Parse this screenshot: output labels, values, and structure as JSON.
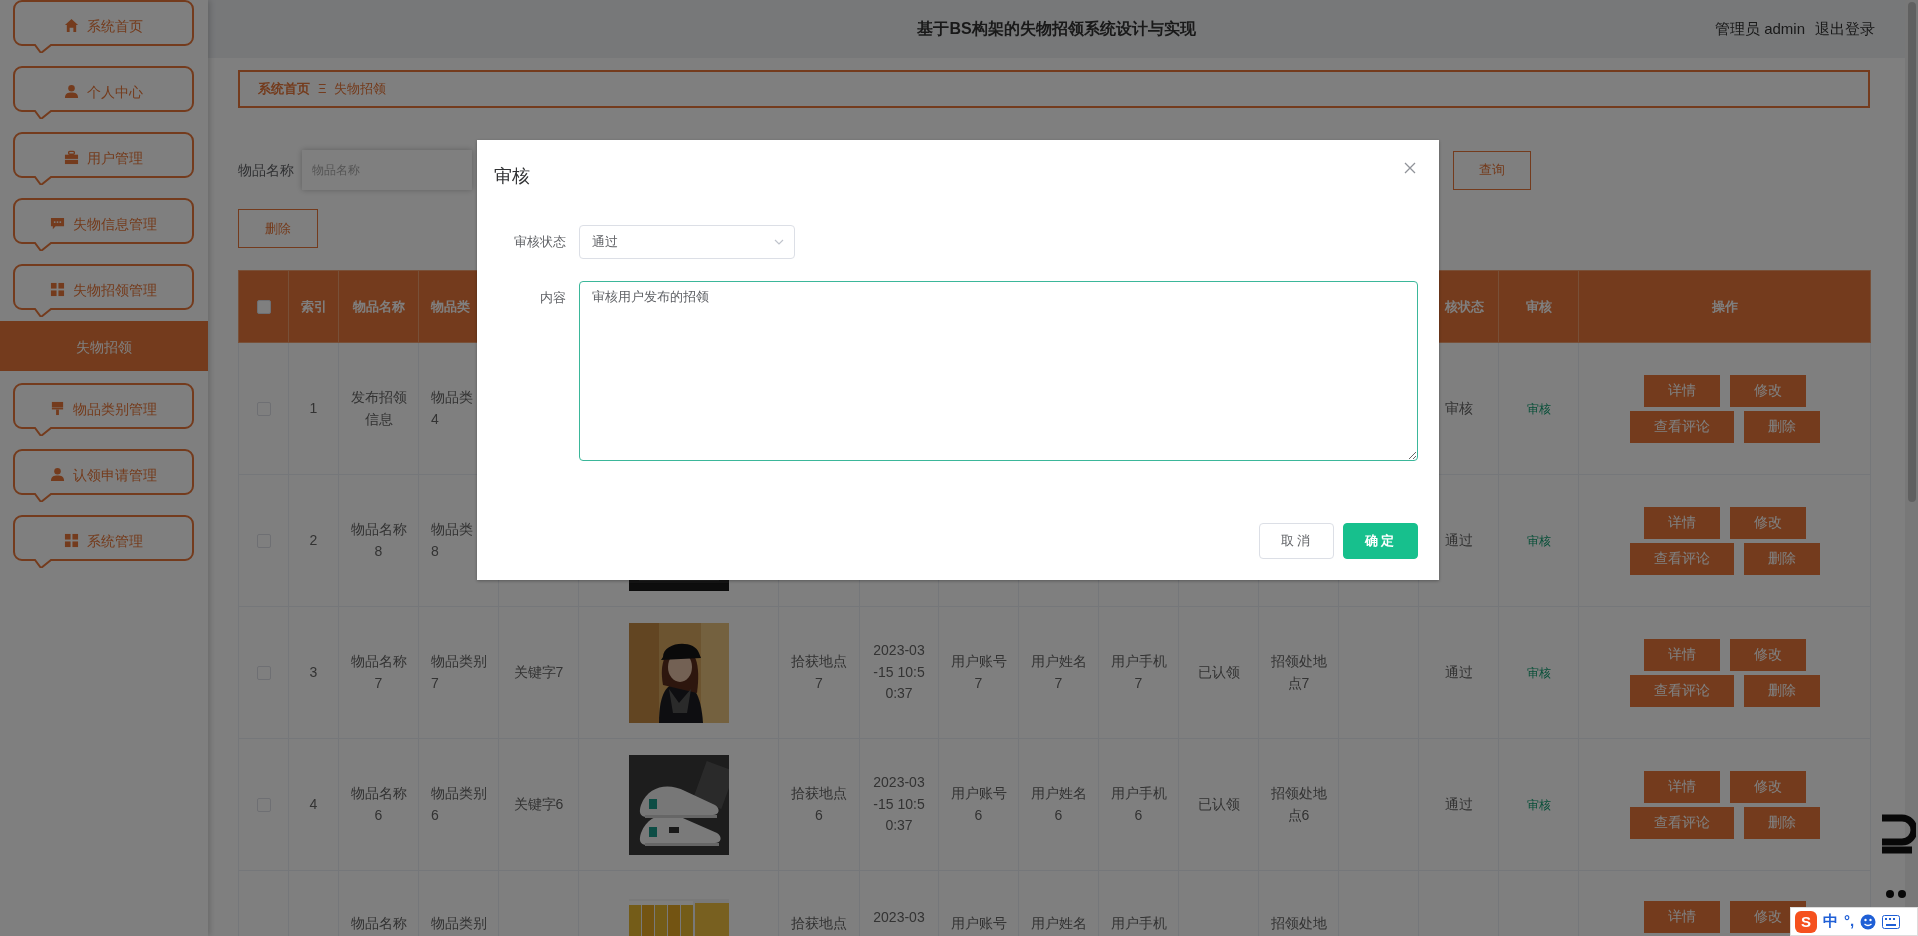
{
  "header": {
    "title": "基于BS构架的失物招领系统设计与实现",
    "user": "管理员 admin",
    "logout": "退出登录"
  },
  "sidebar": {
    "items": [
      {
        "label": "系统首页",
        "selected": false
      },
      {
        "label": "个人中心",
        "selected": false
      },
      {
        "label": "用户管理",
        "selected": false
      },
      {
        "label": "失物信息管理",
        "selected": false
      },
      {
        "label": "失物招领管理",
        "selected": false,
        "children": [
          {
            "label": "失物招领",
            "selected": true
          }
        ]
      },
      {
        "label": "物品类别管理",
        "selected": false
      },
      {
        "label": "认领申请管理",
        "selected": false
      },
      {
        "label": "系统管理",
        "selected": false
      }
    ]
  },
  "breadcrumb": {
    "items": [
      "系统首页",
      "失物招领"
    ],
    "separator": "Ξ"
  },
  "search": {
    "label": "物品名称",
    "placeholder": "物品名称",
    "button": "查询"
  },
  "toolbar": {
    "delete": "删除"
  },
  "table": {
    "all_checked": false,
    "columns": {
      "index": "索引",
      "name": "物品名称",
      "category": "物品类",
      "review_status": "核状态",
      "review": "审核",
      "actions": "操作"
    },
    "rows": [
      {
        "checked": false,
        "index": "1",
        "name": "发布招领信息",
        "category": "物品类\n4",
        "review_status": "审核",
        "review": "审核",
        "actions": [
          "详情",
          "修改",
          "查看评论",
          "删除"
        ]
      },
      {
        "checked": false,
        "index": "2",
        "name": "物品名称8",
        "category": "物品类\n8",
        "photo": {
          "kind": "picture"
        },
        "review_status": "通过",
        "review": "审核",
        "actions": [
          "详情",
          "修改",
          "查看评论",
          "删除"
        ]
      },
      {
        "checked": false,
        "index": "3",
        "name": "物品名称7",
        "category": "物品类别7",
        "keyword": "关键字7",
        "photo": {
          "kind": "picture"
        },
        "location": "拾获地点7",
        "found_time": "2023-03-15 10:50:37",
        "account": "用户账号7",
        "user_name": "用户姓名7",
        "phone": "用户手机7",
        "claim_status": "已认领",
        "claim_place": "招领处地点7",
        "review_status": "通过",
        "review": "审核",
        "actions": [
          "详情",
          "修改",
          "查看评论",
          "删除"
        ]
      },
      {
        "checked": false,
        "index": "4",
        "name": "物品名称6",
        "category": "物品类别6",
        "keyword": "关键字6",
        "photo": {
          "kind": "picture"
        },
        "location": "拾获地点6",
        "found_time": "2023-03-15 10:50:37",
        "account": "用户账号6",
        "user_name": "用户姓名6",
        "phone": "用户手机6",
        "claim_status": "已认领",
        "claim_place": "招领处地点6",
        "review_status": "通过",
        "review": "审核",
        "actions": [
          "详情",
          "修改",
          "查看评论",
          "删除"
        ]
      },
      {
        "name": "物品名称",
        "category": "物品类别",
        "photo": {
          "kind": "picture"
        },
        "location": "拾获地点",
        "found_time": "2023-03",
        "account": "用户账号",
        "user_name": "用户姓名",
        "phone": "用户手机",
        "claim_place": "招领处地",
        "actions": [
          "详情",
          "修改"
        ]
      }
    ]
  },
  "dialog": {
    "title": "审核",
    "fields": [
      {
        "kind": "select",
        "label": "审核状态",
        "value": "通过"
      },
      {
        "kind": "textarea",
        "label": "内容",
        "value": "审核用户发布的招领"
      }
    ],
    "buttons": [
      {
        "label": "取消",
        "kind": "default"
      },
      {
        "label": "确定",
        "kind": "primary"
      }
    ]
  },
  "ime": {
    "logo": "S",
    "items": [
      "中",
      "°,"
    ]
  }
}
